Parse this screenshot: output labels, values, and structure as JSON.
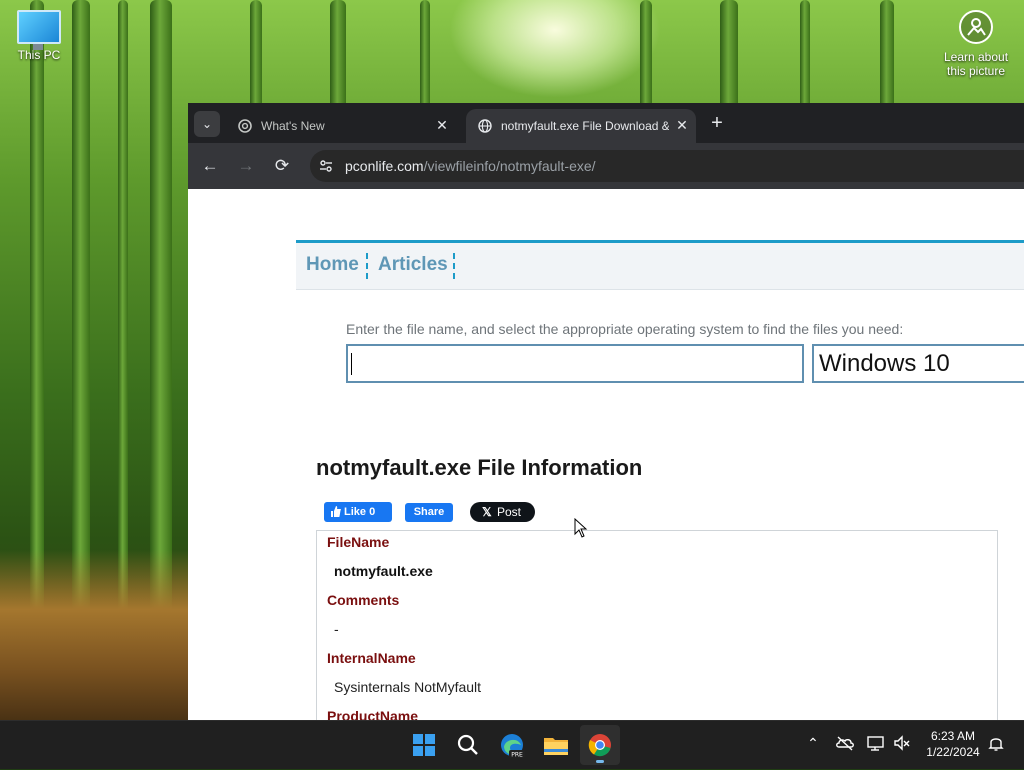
{
  "desktop": {
    "icons": [
      {
        "label": "This PC"
      },
      {
        "label": "Learn about this picture"
      }
    ]
  },
  "browser": {
    "tabs": [
      {
        "title": "What's New",
        "favicon": "chrome-icon",
        "active": false
      },
      {
        "title": "notmyfault.exe File Download &",
        "favicon": "globe-icon",
        "active": true
      }
    ],
    "url_host": "pconlife.com",
    "url_path": "/viewfileinfo/notmyfault-exe/"
  },
  "page": {
    "nav": {
      "home": "Home",
      "articles": "Articles"
    },
    "search_prompt": "Enter the file name, and select the appropriate operating system to find the files you need:",
    "search_value": "",
    "os_selected": "Windows 10",
    "title": "notmyfault.exe File Information",
    "social": {
      "fb_like": "Like 0",
      "fb_share": "Share",
      "x_post": "Post"
    },
    "fields": [
      {
        "label": "FileName",
        "value": "notmyfault.exe"
      },
      {
        "label": "Comments",
        "value": "-"
      },
      {
        "label": "InternalName",
        "value": "Sysinternals NotMyfault"
      },
      {
        "label": "ProductName",
        "value": ""
      }
    ]
  },
  "taskbar": {
    "apps": [
      "start-icon",
      "search-icon",
      "edge-beta-icon",
      "file-explorer-icon",
      "chrome-icon"
    ],
    "active_app": "chrome-icon",
    "clock": {
      "time": "6:23 AM",
      "date": "1/22/2024"
    }
  },
  "colors": {
    "accent_blue": "#1d9bc8",
    "nav_link": "#5f97b6",
    "field_label": "#7a0f0f",
    "facebook": "#1877f2",
    "taskbar_bg": "#202020",
    "browser_tabbar": "#202124"
  }
}
